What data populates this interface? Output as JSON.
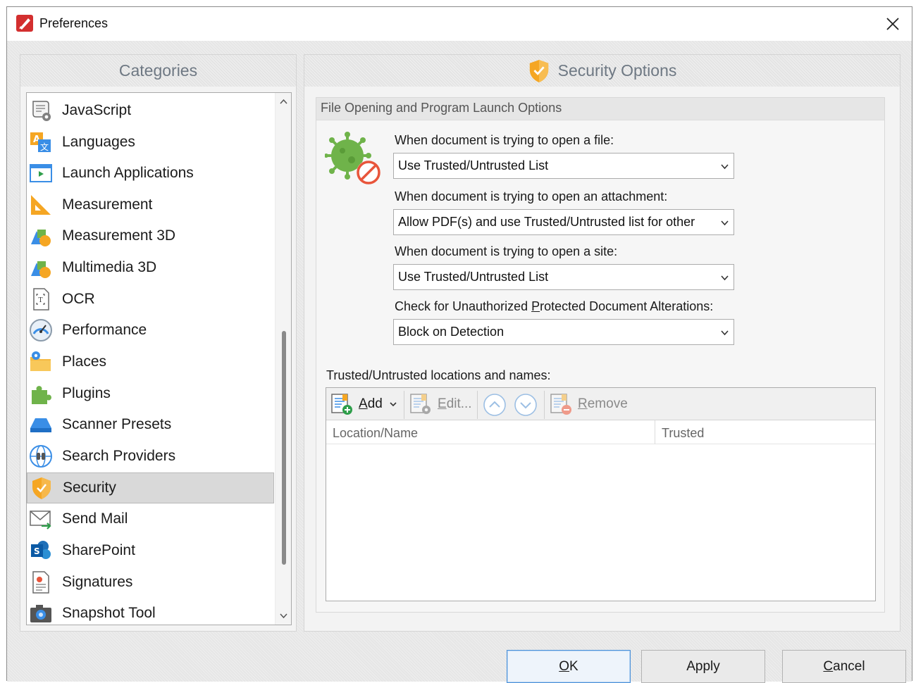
{
  "window": {
    "title": "Preferences"
  },
  "categories": {
    "header": "Categories",
    "items": [
      {
        "label": "JavaScript",
        "icon": "javascript-icon"
      },
      {
        "label": "Languages",
        "icon": "languages-icon"
      },
      {
        "label": "Launch Applications",
        "icon": "launch-applications-icon"
      },
      {
        "label": "Measurement",
        "icon": "measurement-icon"
      },
      {
        "label": "Measurement 3D",
        "icon": "measurement-3d-icon"
      },
      {
        "label": "Multimedia 3D",
        "icon": "multimedia-3d-icon"
      },
      {
        "label": "OCR",
        "icon": "ocr-icon"
      },
      {
        "label": "Performance",
        "icon": "performance-icon"
      },
      {
        "label": "Places",
        "icon": "places-icon"
      },
      {
        "label": "Plugins",
        "icon": "plugins-icon"
      },
      {
        "label": "Scanner Presets",
        "icon": "scanner-presets-icon"
      },
      {
        "label": "Search Providers",
        "icon": "search-providers-icon"
      },
      {
        "label": "Security",
        "icon": "security-icon",
        "selected": true
      },
      {
        "label": "Send Mail",
        "icon": "send-mail-icon"
      },
      {
        "label": "SharePoint",
        "icon": "sharepoint-icon"
      },
      {
        "label": "Signatures",
        "icon": "signatures-icon"
      },
      {
        "label": "Snapshot Tool",
        "icon": "snapshot-tool-icon"
      }
    ]
  },
  "options": {
    "header": "Security Options",
    "group_title": "File Opening and Program Launch Options",
    "open_file": {
      "label": "When document is trying to open a file:",
      "value": "Use Trusted/Untrusted List"
    },
    "open_attachment": {
      "label": "When document is trying to open an attachment:",
      "value": "Allow PDF(s) and use Trusted/Untrusted list for other"
    },
    "open_site": {
      "label": "When document is trying to open a site:",
      "value": "Use Trusted/Untrusted List"
    },
    "alterations": {
      "label_before": "Check for Unauthorized ",
      "label_accel": "P",
      "label_after": "rotected Document Alterations:",
      "value": "Block on Detection"
    },
    "list_label": "Trusted/Untrusted locations and names:",
    "toolbar": {
      "add_accel": "A",
      "add_rest": "dd",
      "edit_accel": "E",
      "edit_rest": "dit...",
      "remove_accel": "R",
      "remove_rest": "emove"
    },
    "columns": [
      "Location/Name",
      "Trusted"
    ]
  },
  "buttons": {
    "ok_accel": "O",
    "ok_rest": "K",
    "apply": "Apply",
    "cancel_accel": "C",
    "cancel_rest": "ancel"
  },
  "colors": {
    "shield_orange": "#f5a623",
    "virus_green": "#6fb34a",
    "no_red": "#e8553b",
    "header_text": "#6e7883"
  }
}
